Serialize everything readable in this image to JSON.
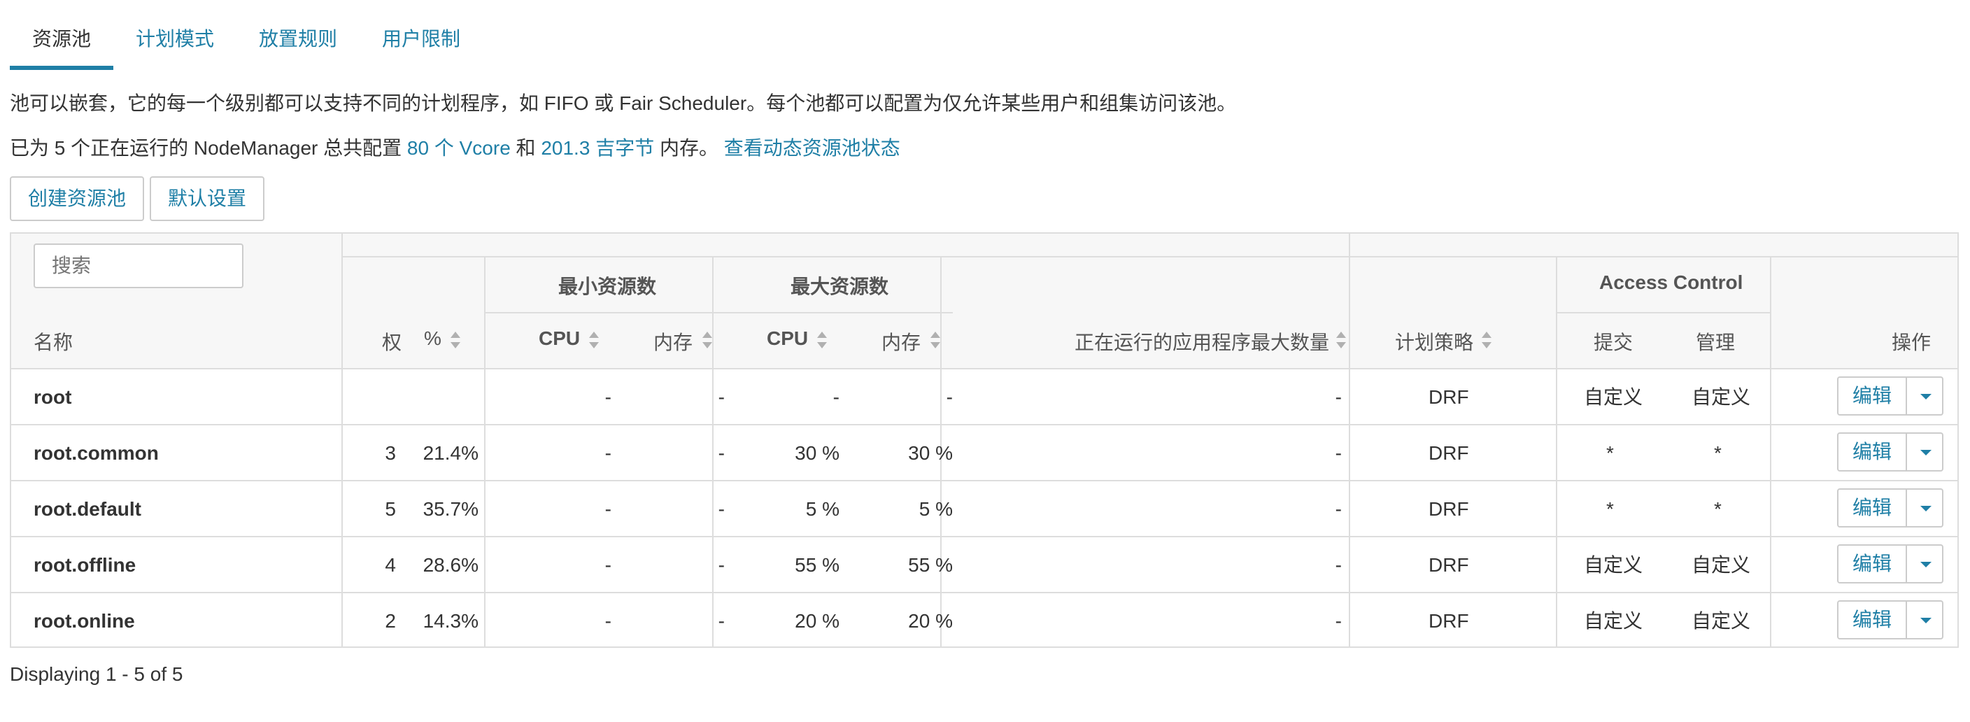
{
  "tabs": [
    "资源池",
    "计划模式",
    "放置规则",
    "用户限制"
  ],
  "description": "池可以嵌套，它的每一个级别都可以支持不同的计划程序，如 FIFO 或 Fair Scheduler。每个池都可以配置为仅允许某些用户和组集访问该池。",
  "summary": {
    "prefix": "已为 5 个正在运行的 NodeManager 总共配置 ",
    "vcores": "80 个 Vcore",
    "and": " 和 ",
    "memory": "201.3 吉字节",
    "suffix": " 内存。 ",
    "dynamic_link": "查看动态资源池状态"
  },
  "buttons": {
    "create": "创建资源池",
    "defaults": "默认设置"
  },
  "search": {
    "placeholder": "搜索"
  },
  "headers": {
    "name": "名称",
    "weight": "权",
    "percent": "%",
    "min_group": "最小资源数",
    "max_group": "最大资源数",
    "cpu": "CPU",
    "memory": "内存",
    "max_apps": "正在运行的应用程序最大数量",
    "policy": "计划策略",
    "access_control": "Access Control",
    "submit": "提交",
    "admin": "管理",
    "actions": "操作"
  },
  "rows": [
    {
      "name": "root",
      "weight": "",
      "percent": "",
      "min_cpu": "-",
      "min_mem": "-",
      "max_cpu": "-",
      "max_mem": "-",
      "max_apps": "-",
      "policy": "DRF",
      "submit": "自定义",
      "admin": "自定义",
      "edit": "编辑"
    },
    {
      "name": "root.common",
      "weight": "3",
      "percent": "21.4%",
      "min_cpu": "-",
      "min_mem": "-",
      "max_cpu": "30 %",
      "max_mem": "30 %",
      "max_apps": "-",
      "policy": "DRF",
      "submit": "*",
      "admin": "*",
      "edit": "编辑"
    },
    {
      "name": "root.default",
      "weight": "5",
      "percent": "35.7%",
      "min_cpu": "-",
      "min_mem": "-",
      "max_cpu": "5 %",
      "max_mem": "5 %",
      "max_apps": "-",
      "policy": "DRF",
      "submit": "*",
      "admin": "*",
      "edit": "编辑"
    },
    {
      "name": "root.offline",
      "weight": "4",
      "percent": "28.6%",
      "min_cpu": "-",
      "min_mem": "-",
      "max_cpu": "55 %",
      "max_mem": "55 %",
      "max_apps": "-",
      "policy": "DRF",
      "submit": "自定义",
      "admin": "自定义",
      "edit": "编辑"
    },
    {
      "name": "root.online",
      "weight": "2",
      "percent": "14.3%",
      "min_cpu": "-",
      "min_mem": "-",
      "max_cpu": "20 %",
      "max_mem": "20 %",
      "max_apps": "-",
      "policy": "DRF",
      "submit": "自定义",
      "admin": "自定义",
      "edit": "编辑"
    }
  ],
  "footer": "Displaying 1 - 5 of 5",
  "colors": {
    "accent": "#1f7fa6",
    "header_bg": "#f7f7f7",
    "border": "#dddddd"
  }
}
